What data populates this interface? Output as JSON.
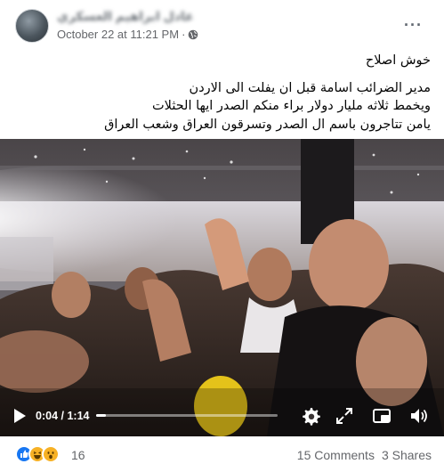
{
  "post": {
    "author": "عادل ابراهيم العسكري",
    "timestamp": "October 22 at 11:21 PM",
    "separator": "·",
    "privacy_icon": "globe-icon",
    "more_label": "···",
    "text": {
      "line1": "خوش اصلاح",
      "line2": "مدير الضرائب اسامة قبل ان يفلت الى الاردن",
      "line3": "ويخمط ثلاثه مليار دولار براء منكم الصدر ايها الحثلات",
      "line4": "يامن تتاجرون باسم ال الصدر وتسرقون العراق وشعب العراق"
    }
  },
  "video": {
    "current_time": "0:04",
    "duration": "1:14",
    "time_separator": " / ",
    "progress": 0.054,
    "icons": [
      "play-icon",
      "settings-icon",
      "fullscreen-icon",
      "picture-in-picture-icon",
      "volume-icon"
    ]
  },
  "footer": {
    "reaction_count": "16",
    "comments": "15 Comments",
    "shares": "3 Shares",
    "reaction_icons": [
      "like-reaction-icon",
      "haha-reaction-icon",
      "wow-reaction-icon"
    ]
  }
}
